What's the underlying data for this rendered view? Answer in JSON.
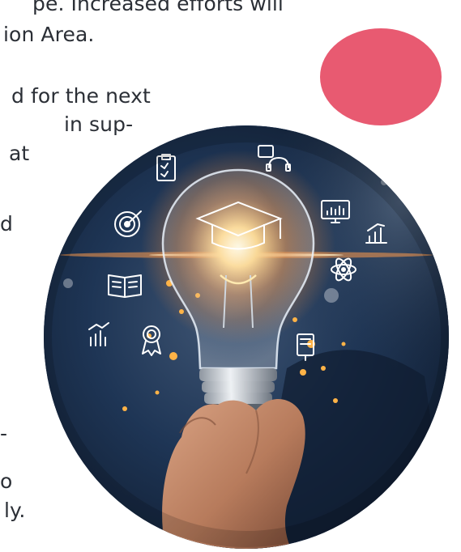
{
  "text_fragments": [
    "pe. Increased efforts will",
    "ion Area.",
    "d for the next",
    "in sup-",
    "at",
    "d",
    "-",
    "o",
    "ly."
  ],
  "colors": {
    "accent": "#e85a71",
    "text": "#2b2f36",
    "bulb_glow": "#ffb347"
  },
  "photo": {
    "icons": [
      "clipboard-checklist-icon",
      "chat-headset-icon",
      "target-icon",
      "monitor-chart-icon",
      "bar-chart-icon",
      "atom-icon",
      "open-book-icon",
      "analytics-icon",
      "award-badge-icon",
      "book-icon",
      "graduation-cap-icon"
    ]
  }
}
